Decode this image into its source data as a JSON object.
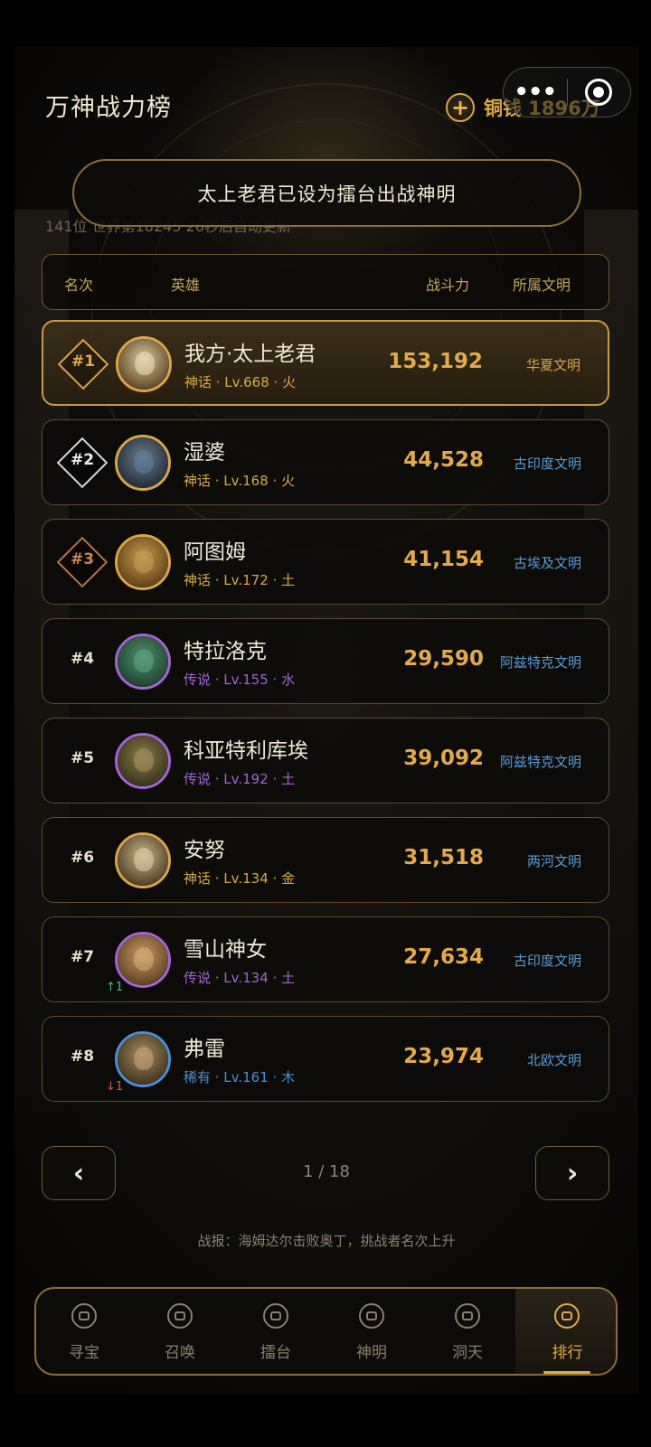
{
  "header": {
    "title": "万神战力榜",
    "coin_icon": "plus-circle-icon",
    "coin_text": "铜钱 1896万"
  },
  "capsule": {
    "more": "•••",
    "target_icon": "target-icon"
  },
  "subinfo": "141位   世界第18245   26秒后自动更新",
  "toast": "太上老君已设为擂台出战神明",
  "table": {
    "headers": {
      "rank": "名次",
      "hero": "英雄",
      "power": "战斗力",
      "civ": "所属文明"
    },
    "rows": [
      {
        "rank": "#1",
        "name": "我方·太上老君",
        "meta": "神话 · Lv.668 · 火",
        "power": "153,192",
        "civ": "华夏文明",
        "trend": ""
      },
      {
        "rank": "#2",
        "name": "湿婆",
        "meta": "神话 · Lv.168 · 火",
        "power": "44,528",
        "civ": "古印度文明",
        "trend": ""
      },
      {
        "rank": "#3",
        "name": "阿图姆",
        "meta": "神话 · Lv.172 · 土",
        "power": "41,154",
        "civ": "古埃及文明",
        "trend": ""
      },
      {
        "rank": "#4",
        "name": "特拉洛克",
        "meta": "传说 · Lv.155 · 水",
        "power": "29,590",
        "civ": "阿兹特克文明",
        "trend": ""
      },
      {
        "rank": "#5",
        "name": "科亚特利库埃",
        "meta": "传说 · Lv.192 · 土",
        "power": "39,092",
        "civ": "阿兹特克文明",
        "trend": ""
      },
      {
        "rank": "#6",
        "name": "安努",
        "meta": "神话 · Lv.134 · 金",
        "power": "31,518",
        "civ": "两河文明",
        "trend": ""
      },
      {
        "rank": "#7",
        "name": "雪山神女",
        "meta": "传说 · Lv.134 · 土",
        "power": "27,634",
        "civ": "古印度文明",
        "trend": "↑1"
      },
      {
        "rank": "#8",
        "name": "弗雷",
        "meta": "稀有 · Lv.161 · 木",
        "power": "23,974",
        "civ": "北欧文明",
        "trend": "↓1"
      }
    ]
  },
  "pager": {
    "prev": "‹",
    "next": "›",
    "text": "1 / 18"
  },
  "report": "战报：海姆达尔击败奥丁，挑战者名次上升",
  "nav": {
    "items": [
      {
        "label": "寻宝",
        "icon": "treasure-icon"
      },
      {
        "label": "召唤",
        "icon": "summon-icon"
      },
      {
        "label": "擂台",
        "icon": "arena-icon"
      },
      {
        "label": "神明",
        "icon": "god-icon"
      },
      {
        "label": "洞天",
        "icon": "cave-icon"
      },
      {
        "label": "排行",
        "icon": "ranking-icon"
      }
    ],
    "active": "排行"
  },
  "colors": {
    "gold": "#e2aa4b",
    "mythic_text": "#d9a84a",
    "legend_text": "#a365d6",
    "rare_text": "#4a8fd6",
    "civ_gold": "#d9a54a",
    "civ_blue": "#5b9bd5",
    "trend_up": "#4fbf7a",
    "trend_down": "#e0553f"
  }
}
